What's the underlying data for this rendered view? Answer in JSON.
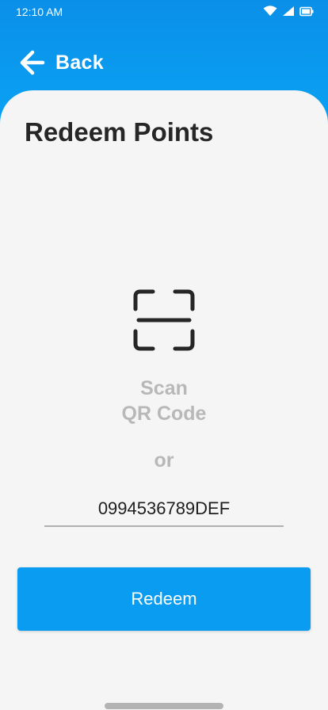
{
  "status_bar": {
    "time": "12:10 AM",
    "icons": [
      "wifi-icon",
      "cellular-signal-icon",
      "battery-icon"
    ]
  },
  "header": {
    "back_label": "Back",
    "back_icon": "arrow-left-icon"
  },
  "page": {
    "title": "Redeem Points"
  },
  "scan": {
    "icon": "qr-scan-icon",
    "line1": "Scan",
    "line2": "QR Code"
  },
  "separator": {
    "label": "or"
  },
  "code_input": {
    "value": "0994536789DEF"
  },
  "redeem_button": {
    "label": "Redeem"
  },
  "colors": {
    "primary": "#0a9cf0",
    "background": "#f5f5f5",
    "title_text": "#262626",
    "muted_text": "#b8b8b8"
  }
}
